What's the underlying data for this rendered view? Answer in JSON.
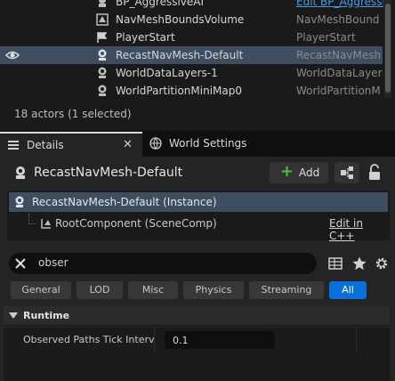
{
  "outliner": {
    "rows": [
      {
        "name": "BP_AggressiveAI",
        "type": "Edit BP_Aggressi",
        "type_is_link": true,
        "selected": false,
        "visible_eye": false
      },
      {
        "name": "NavMeshBoundsVolume",
        "type": "NavMeshBound",
        "type_is_link": false,
        "selected": false,
        "visible_eye": false
      },
      {
        "name": "PlayerStart",
        "type": "PlayerStart",
        "type_is_link": false,
        "selected": false,
        "visible_eye": false
      },
      {
        "name": "RecastNavMesh-Default",
        "type": "RecastNavMesh",
        "type_is_link": false,
        "selected": true,
        "visible_eye": true
      },
      {
        "name": "WorldDataLayers-1",
        "type": "WorldDataLayer",
        "type_is_link": false,
        "selected": false,
        "visible_eye": false
      },
      {
        "name": "WorldPartitionMiniMap0",
        "type": "WorldPartitionM",
        "type_is_link": false,
        "selected": false,
        "visible_eye": false
      }
    ],
    "status": "18 actors (1 selected)"
  },
  "tabs": {
    "details_label": "Details",
    "details_close": "✕",
    "world_settings_label": "World Settings"
  },
  "details": {
    "actor_name": "RecastNavMesh-Default",
    "add_label": "Add",
    "components": {
      "instance_label": "RecastNavMesh-Default (Instance)",
      "root_label": "RootComponent (SceneComp)",
      "edit_cpp": "Edit in C++"
    },
    "search": {
      "value": "obser"
    },
    "filters": [
      {
        "label": "General",
        "active": false
      },
      {
        "label": "LOD",
        "active": false
      },
      {
        "label": "Misc",
        "active": false
      },
      {
        "label": "Physics",
        "active": false
      },
      {
        "label": "Streaming",
        "active": false
      },
      {
        "label": "All",
        "active": true
      }
    ],
    "category": "Runtime",
    "property": {
      "label": "Observed Paths Tick Interv...",
      "value": "0.1"
    }
  },
  "colors": {
    "selected_row": "#3e4e60",
    "active_filter": "#0a6fd6",
    "add_plus": "#4fbd3a",
    "link": "#4a9ae8"
  }
}
